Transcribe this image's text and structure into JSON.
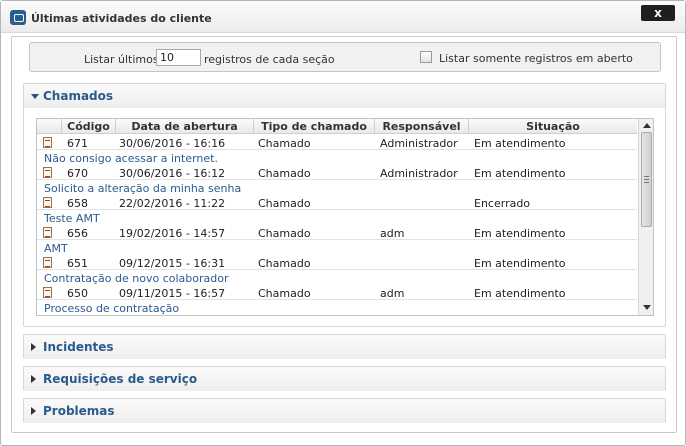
{
  "window": {
    "title": "Últimas atividades do cliente",
    "close_label": "x",
    "title_icon": "chat-bubble-icon"
  },
  "filter": {
    "label_before": "Listar últimos",
    "count_value": "10",
    "label_after": "registros de cada seção",
    "open_only_label": "Listar somente registros em aberto",
    "open_only_checked": false
  },
  "sections": {
    "chamados": {
      "title": "Chamados",
      "expanded": true
    },
    "incidentes": {
      "title": "Incidentes",
      "expanded": false
    },
    "requisicoes": {
      "title": "Requisições de serviço",
      "expanded": false
    },
    "problemas": {
      "title": "Problemas",
      "expanded": false
    }
  },
  "table": {
    "columns": [
      "Código",
      "Data de abertura",
      "Tipo de chamado",
      "Responsável",
      "Situação"
    ],
    "rows": [
      {
        "codigo": "671",
        "data": "30/06/2016 - 16:16",
        "tipo": "Chamado",
        "responsavel": "Administrador",
        "situacao": "Em atendimento",
        "descricao": "Não consigo acessar a internet."
      },
      {
        "codigo": "670",
        "data": "30/06/2016 - 16:12",
        "tipo": "Chamado",
        "responsavel": "Administrador",
        "situacao": "Em atendimento",
        "descricao": "Solicito a alteração da minha senha"
      },
      {
        "codigo": "658",
        "data": "22/02/2016 - 11:22",
        "tipo": "Chamado",
        "responsavel": "",
        "situacao": "Encerrado",
        "descricao": "Teste AMT"
      },
      {
        "codigo": "656",
        "data": "19/02/2016 - 14:57",
        "tipo": "Chamado",
        "responsavel": "adm",
        "situacao": "Em atendimento",
        "descricao": "AMT"
      },
      {
        "codigo": "651",
        "data": "09/12/2015 - 16:31",
        "tipo": "Chamado",
        "responsavel": "",
        "situacao": "Em atendimento",
        "descricao": "Contratação de novo colaborador"
      },
      {
        "codigo": "650",
        "data": "09/11/2015 - 16:57",
        "tipo": "Chamado",
        "responsavel": "adm",
        "situacao": "Em atendimento",
        "descricao": "Processo de contratação"
      }
    ]
  },
  "colors": {
    "accent": "#2b5b8b",
    "link": "#2a5b8f"
  }
}
